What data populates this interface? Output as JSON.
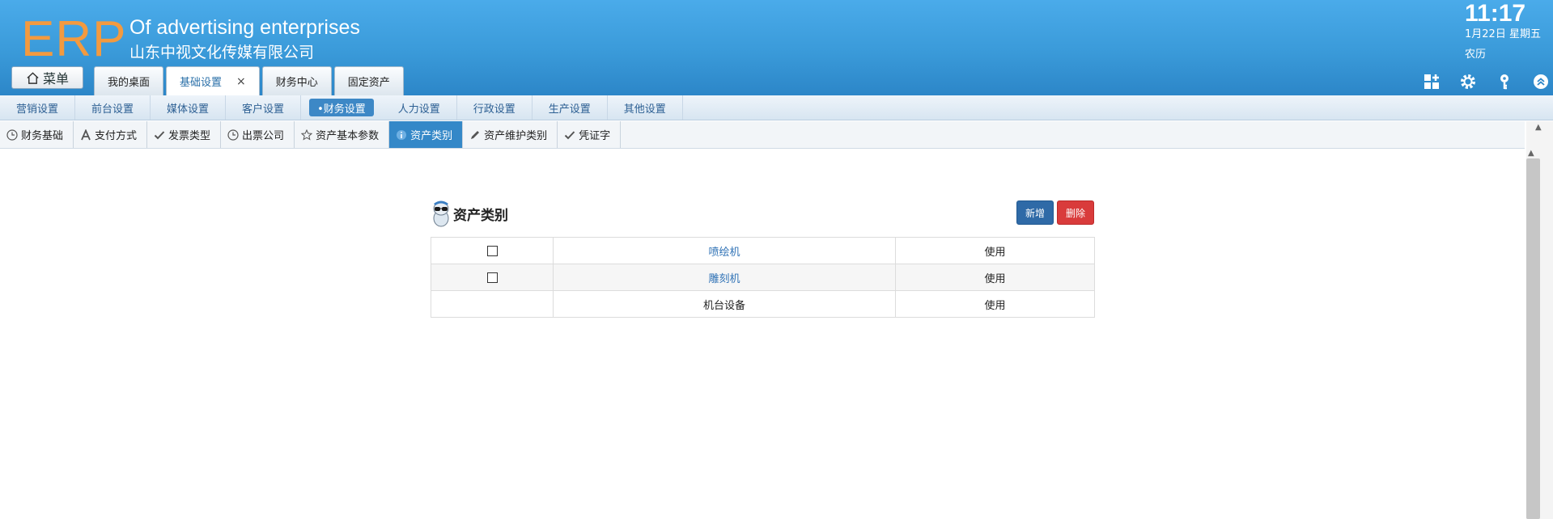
{
  "header": {
    "logo": "ERP",
    "company_en": "Of advertising enterprises",
    "company_cn": "山东中视文化传媒有限公司",
    "time": "11:17",
    "date": "1月22日 星期五",
    "lunar": "农历",
    "menu_label": "菜单",
    "tabs": [
      {
        "label": "我的桌面"
      },
      {
        "label": "基础设置",
        "active": true,
        "close": "×"
      },
      {
        "label": "财务中心"
      },
      {
        "label": "固定资产"
      }
    ],
    "icons": [
      "grid-add-icon",
      "gear-icon",
      "key-icon",
      "collapse-up-icon"
    ]
  },
  "settings_nav": {
    "items": [
      "营销设置",
      "前台设置",
      "媒体设置",
      "客户设置",
      "•财务设置",
      "人力设置",
      "行政设置",
      "生产设置",
      "其他设置"
    ],
    "active_index": 4
  },
  "sub_nav": {
    "items": [
      {
        "label": "财务基础",
        "icon": "clock-icon"
      },
      {
        "label": "支付方式",
        "icon": "letter-a-icon"
      },
      {
        "label": "发票类型",
        "icon": "check-icon"
      },
      {
        "label": "出票公司",
        "icon": "clock-icon"
      },
      {
        "label": "资产基本参数",
        "icon": "star-icon"
      },
      {
        "label": "资产类别",
        "icon": "info-icon",
        "active": true
      },
      {
        "label": "资产维护类别",
        "icon": "pencil-icon"
      },
      {
        "label": "凭证字",
        "icon": "check-icon"
      }
    ]
  },
  "panel": {
    "title": "资产类别",
    "add_label": "新增",
    "delete_label": "删除",
    "rows": [
      {
        "name": "喷绘机",
        "status": "使用",
        "checkbox": true,
        "link": true
      },
      {
        "name": "雕刻机",
        "status": "使用",
        "checkbox": true,
        "link": true
      },
      {
        "name": "机台设备",
        "status": "使用",
        "checkbox": false,
        "link": false
      }
    ]
  },
  "colors": {
    "header_blue": "#3a9ad9",
    "logo_orange": "#f39a3f",
    "active_blue": "#3488c8",
    "add_button": "#2f6aa7",
    "delete_button": "#d93b3b",
    "link": "#3173b6"
  }
}
